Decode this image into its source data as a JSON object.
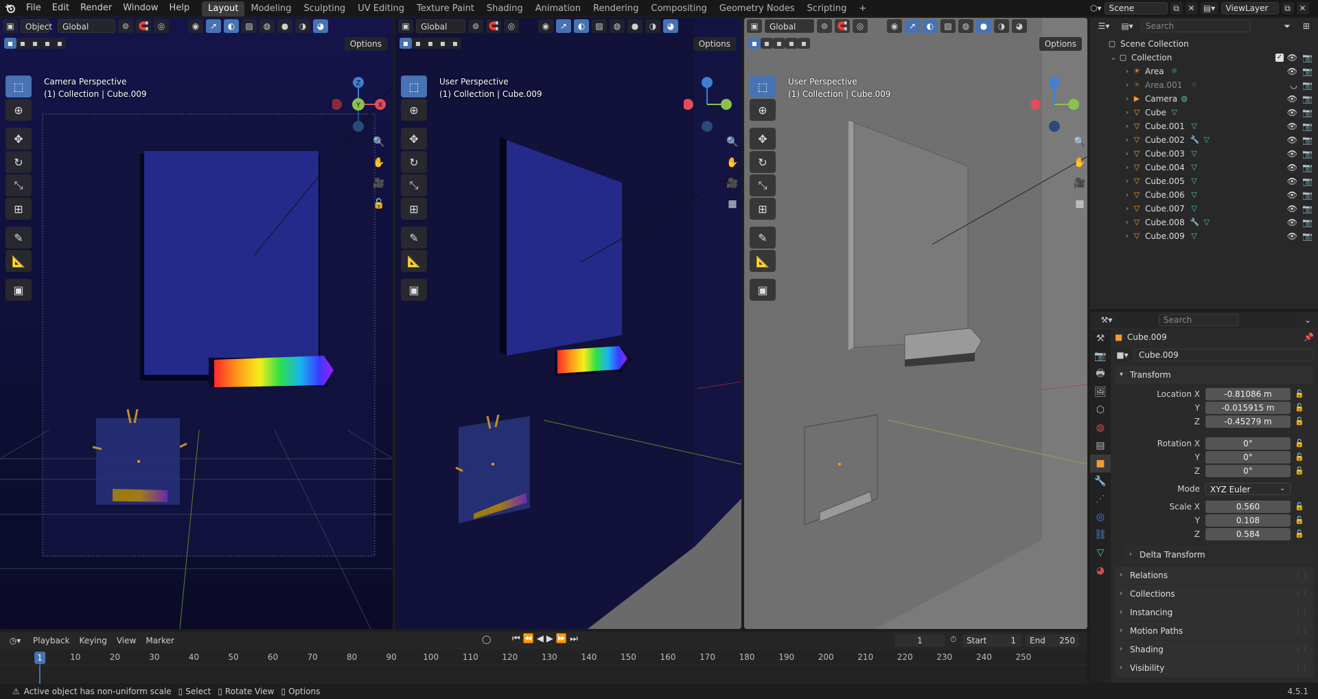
{
  "menu": {
    "items": [
      "File",
      "Edit",
      "Render",
      "Window",
      "Help"
    ],
    "workspaces": [
      "Layout",
      "Modeling",
      "Sculpting",
      "UV Editing",
      "Texture Paint",
      "Shading",
      "Animation",
      "Rendering",
      "Compositing",
      "Geometry Nodes",
      "Scripting"
    ],
    "active_workspace": "Layout",
    "add_tab": "+",
    "scene": "Scene",
    "view_layer": "ViewLayer"
  },
  "viewports": [
    {
      "mode": "Object",
      "orientation": "Global",
      "options": "Options",
      "title": "Camera Perspective",
      "subtitle": "(1) Collection | Cube.009",
      "gizmo": {
        "z": "Z",
        "y": "Y",
        "x": "X"
      }
    },
    {
      "orientation": "Global",
      "options": "Options",
      "title": "User Perspective",
      "subtitle": "(1) Collection | Cube.009"
    },
    {
      "orientation": "Global",
      "options": "Options",
      "title": "User Perspective",
      "subtitle": "(1) Collection | Cube.009"
    }
  ],
  "outliner": {
    "search_placeholder": "Search",
    "scene_collection": "Scene Collection",
    "collection": "Collection",
    "items": [
      {
        "name": "Area",
        "kind": "light",
        "dim": false
      },
      {
        "name": "Area.001",
        "kind": "light",
        "dim": true
      },
      {
        "name": "Camera",
        "kind": "camera",
        "dim": false
      },
      {
        "name": "Cube",
        "kind": "mesh",
        "dim": false
      },
      {
        "name": "Cube.001",
        "kind": "mesh",
        "dim": false
      },
      {
        "name": "Cube.002",
        "kind": "mesh-mod",
        "dim": false
      },
      {
        "name": "Cube.003",
        "kind": "mesh",
        "dim": false
      },
      {
        "name": "Cube.004",
        "kind": "mesh",
        "dim": false
      },
      {
        "name": "Cube.005",
        "kind": "mesh",
        "dim": false
      },
      {
        "name": "Cube.006",
        "kind": "mesh",
        "dim": false
      },
      {
        "name": "Cube.007",
        "kind": "mesh",
        "dim": false
      },
      {
        "name": "Cube.008",
        "kind": "mesh-mod",
        "dim": false
      },
      {
        "name": "Cube.009",
        "kind": "mesh",
        "dim": false
      }
    ]
  },
  "properties": {
    "search_placeholder": "Search",
    "object_name": "Cube.009",
    "datablock_name": "Cube.009",
    "transform_label": "Transform",
    "location": {
      "label": "Location X",
      "x": "-0.81086 m",
      "y": "-0.015915 m",
      "z": "-0.45279 m"
    },
    "rotation": {
      "label": "Rotation X",
      "x": "0°",
      "y": "0°",
      "z": "0°"
    },
    "mode_label": "Mode",
    "mode_value": "XYZ Euler",
    "scale": {
      "label": "Scale X",
      "x": "0.560",
      "y": "0.108",
      "z": "0.584"
    },
    "axis_y": "Y",
    "axis_z": "Z",
    "delta_transform": "Delta Transform",
    "panels": [
      "Relations",
      "Collections",
      "Instancing",
      "Motion Paths",
      "Shading",
      "Visibility"
    ]
  },
  "timeline": {
    "menus": [
      "Playback",
      "Keying",
      "View",
      "Marker"
    ],
    "current_frame": "1",
    "start_label": "Start",
    "start_value": "1",
    "end_label": "End",
    "end_value": "250",
    "ticks": [
      "10",
      "20",
      "30",
      "40",
      "50",
      "60",
      "70",
      "80",
      "90",
      "100",
      "110",
      "120",
      "130",
      "140",
      "150",
      "160",
      "170",
      "180",
      "190",
      "200",
      "210",
      "220",
      "230",
      "240",
      "250"
    ],
    "playhead": "1"
  },
  "status": {
    "warning": "Active object has non-uniform scale",
    "select": "Select",
    "rotate_view": "Rotate View",
    "options": "Options",
    "version": "4.5.1"
  },
  "colors": {
    "accent": "#4772b3",
    "axis_x": "#e64b5a",
    "axis_y": "#8bc34a",
    "axis_z": "#3f7fd6",
    "mesh_icon": "#f29b35",
    "data_icon": "#52c3a8"
  }
}
